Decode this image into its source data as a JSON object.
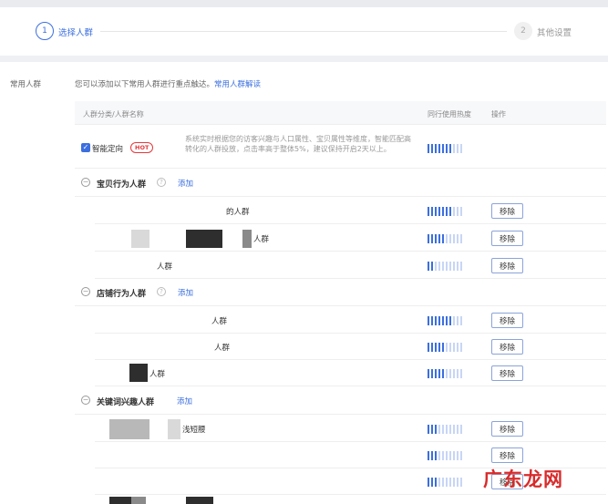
{
  "steps": [
    {
      "num": "1",
      "label": "选择人群"
    },
    {
      "num": "2",
      "label": "其他设置"
    }
  ],
  "section": {
    "side_label": "常用人群",
    "intro_text": "您可以添加以下常用人群进行重点触达。",
    "intro_link": "常用人群解读"
  },
  "table": {
    "col_name": "人群分类/人群名称",
    "col_heat": "同行使用热度",
    "col_action": "操作"
  },
  "smart": {
    "checked": true,
    "name": "智能定向",
    "badge": "HOT",
    "description": "系统实时根据您的访客兴趣与人口属性、宝贝属性等维度，智能匹配高转化的人群投放，点击率高于整体5%，建议保持开启2天以上。",
    "heat_level": 7
  },
  "groups": [
    {
      "title": "宝贝行为人群",
      "add_label": "添加",
      "rows": [
        {
          "name": "的人群",
          "heat_level": 7,
          "remove_label": "移除"
        },
        {
          "name": "人群",
          "heat_level": 5,
          "remove_label": "移除"
        },
        {
          "name": "人群",
          "heat_level": 2,
          "remove_label": "移除"
        }
      ]
    },
    {
      "title": "店铺行为人群",
      "add_label": "添加",
      "rows": [
        {
          "name": "人群",
          "heat_level": 7,
          "remove_label": "移除"
        },
        {
          "name": "人群",
          "heat_level": 5,
          "remove_label": "移除"
        },
        {
          "name": "人群",
          "heat_level": 5,
          "remove_label": "移除"
        }
      ]
    },
    {
      "title": "关键词兴趣人群",
      "add_label": "添加",
      "rows": [
        {
          "name": "浅短腰",
          "heat_level": 3,
          "remove_label": "移除"
        },
        {
          "name": "",
          "heat_level": 3,
          "remove_label": "移除"
        },
        {
          "name": "",
          "heat_level": 3,
          "remove_label": "移除"
        }
      ]
    }
  ],
  "watermark": "广东龙网",
  "colors": {
    "accent": "#3b6fdf",
    "hot": "#e4393c",
    "watermark": "#d82b2b"
  }
}
